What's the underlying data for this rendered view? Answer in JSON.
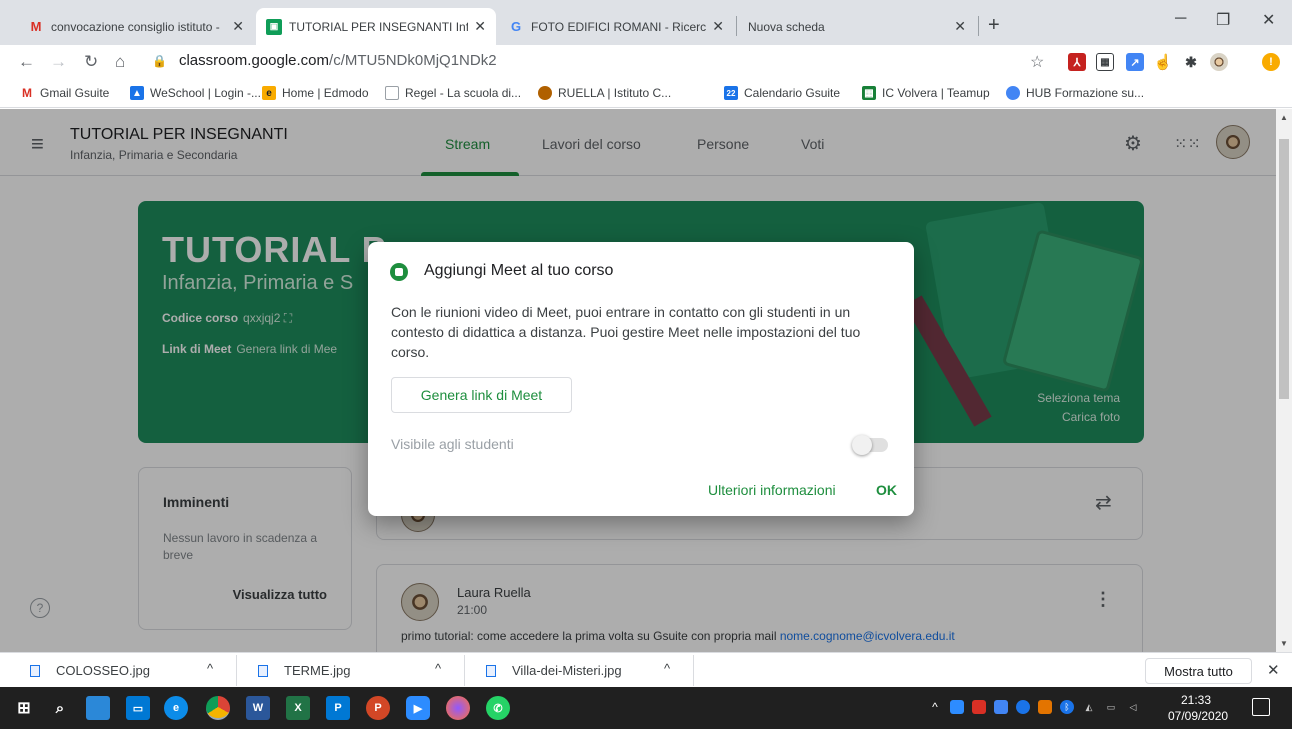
{
  "browser": {
    "tabs": [
      {
        "title": "convocazione consiglio istituto -",
        "icon": "gmail-icon"
      },
      {
        "title": "TUTORIAL PER INSEGNANTI Infa",
        "icon": "classroom-icon"
      },
      {
        "title": "FOTO EDIFICI ROMANI - Ricerca",
        "icon": "google-icon"
      },
      {
        "title": "Nuova scheda",
        "icon": "none"
      }
    ],
    "url_host": "classroom.google.com",
    "url_path": "/c/MTU5NDk0MjQ1NDk2",
    "bookmarks": [
      "Gmail Gsuite",
      "WeSchool | Login -...",
      "Home | Edmodo",
      "Regel - La scuola di...",
      "RUELLA | Istituto C...",
      "Calendario Gsuite",
      "IC Volvera | Teamup",
      "HUB Formazione su..."
    ]
  },
  "classroom": {
    "course_title": "TUTORIAL PER INSEGNANTI",
    "course_subtitle": "Infanzia, Primaria e Secondaria",
    "nav": [
      "Stream",
      "Lavori del corso",
      "Persone",
      "Voti"
    ],
    "banner": {
      "title": "TUTORIAL P",
      "subtitle": "Infanzia, Primaria e S",
      "code_label": "Codice corso",
      "code_value": "qxxjqj2",
      "meet_label": "Link di Meet",
      "meet_value": "Genera link di Mee",
      "select_theme": "Seleziona tema",
      "upload_photo": "Carica foto"
    },
    "upcoming": {
      "title": "Imminenti",
      "text": "Nessun lavoro in scadenza a breve",
      "link": "Visualizza tutto"
    },
    "post": {
      "author": "Laura Ruella",
      "time": "21:00",
      "text": "primo tutorial:  come accedere la prima volta su Gsuite con propria mail ",
      "mail": "nome.cognome@icvolvera.edu.it"
    }
  },
  "dialog": {
    "title": "Aggiungi Meet al tuo corso",
    "body": "Con le riunioni video di Meet, puoi entrare in contatto con gli studenti in un contesto di didattica a distanza. Puoi gestire Meet nelle impostazioni del tuo corso.",
    "generate_button": "Genera link di Meet",
    "visible_label": "Visibile agli studenti",
    "visible_on": false,
    "more_info": "Ulteriori informazioni",
    "ok": "OK"
  },
  "downloads": {
    "files": [
      "COLOSSEO.jpg",
      "TERME.jpg",
      "Villa-dei-Misteri.jpg"
    ],
    "show_all": "Mostra tutto"
  },
  "taskbar": {
    "time": "21:33",
    "date": "07/09/2020"
  },
  "colors": {
    "accent_green": "#1e8e3e",
    "banner_green": "#1e8e5e",
    "link_blue": "#1a73e8"
  }
}
